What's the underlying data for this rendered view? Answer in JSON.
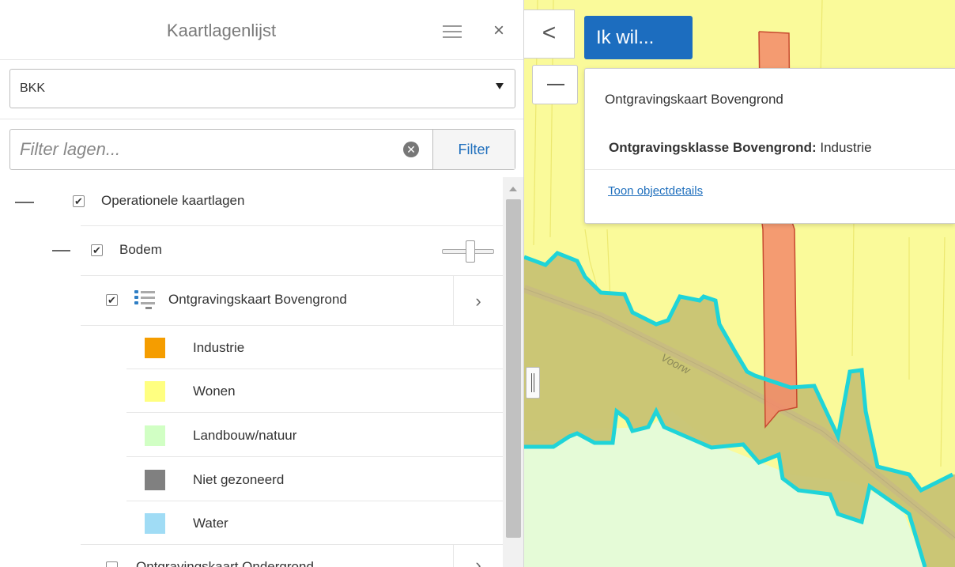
{
  "panel": {
    "title": "Kaartlagenlijst",
    "menu_icon": "hamburger-icon",
    "close_icon": "close-icon",
    "close_glyph": "×"
  },
  "dataset_select": {
    "value": "BKK"
  },
  "filter": {
    "placeholder": "Filter lagen...",
    "value": "",
    "clear_glyph": "✕",
    "button_label": "Filter"
  },
  "tree": {
    "group": {
      "label": "Operationele kaartlagen",
      "checked": true
    },
    "subgroup": {
      "label": "Bodem",
      "checked": true
    },
    "layer": {
      "label": "Ontgravingskaart Bovengrond",
      "checked": true,
      "arrow": "›"
    },
    "legend": [
      {
        "label": "Industrie",
        "color": "#f59d00"
      },
      {
        "label": "Wonen",
        "color": "#ffff80"
      },
      {
        "label": "Landbouw/natuur",
        "color": "#d1ffc4"
      },
      {
        "label": "Niet gezoneerd",
        "color": "#808080"
      },
      {
        "label": "Water",
        "color": "#a0dcf5"
      }
    ],
    "next_layer": {
      "label": "Ontgravingskaart Ondergrond",
      "checked": false,
      "arrow": "›"
    }
  },
  "map": {
    "collapse_glyph": "<",
    "ik_wil_label": "Ik wil...",
    "street_label": "Voorw",
    "colors": {
      "wonen": "#fafa9a",
      "landbouw": "#e5fbd7",
      "selected_area": "#c8c373",
      "selected_outline": "#1fd4d8",
      "industrie_strip": "#f28a6a"
    }
  },
  "popup": {
    "title": "Ontgravingskaart Bovengrond",
    "attribute_name": "Ontgravingsklasse Bovengrond:",
    "attribute_value": " Industrie",
    "link": "Toon objectdetails"
  }
}
